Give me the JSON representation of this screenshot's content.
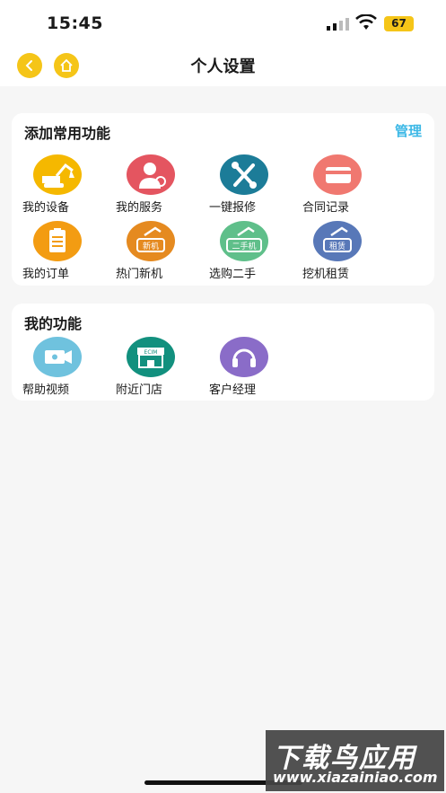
{
  "status": {
    "time": "15:45",
    "battery": "67"
  },
  "nav": {
    "title": "个人设置"
  },
  "common": {
    "title": "添加常用功能",
    "manage": "管理",
    "items": [
      {
        "label": "我的设备",
        "icon": "excavator-icon",
        "color": "#f5b800"
      },
      {
        "label": "我的服务",
        "icon": "service-person-icon",
        "color": "#e45560"
      },
      {
        "label": "一键报修",
        "icon": "tools-icon",
        "color": "#1c7c98"
      },
      {
        "label": "合同记录",
        "icon": "card-icon",
        "color": "#f07870"
      },
      {
        "label": "我的订单",
        "icon": "clipboard-icon",
        "color": "#f39c12"
      },
      {
        "label": "热门新机",
        "icon": "new-machine-icon",
        "color": "#e58a20",
        "badge": "新机"
      },
      {
        "label": "选购二手",
        "icon": "used-machine-icon",
        "color": "#5fbf8a",
        "badge": "二手机"
      },
      {
        "label": "挖机租赁",
        "icon": "rental-machine-icon",
        "color": "#5878b8",
        "badge": "租赁"
      }
    ]
  },
  "mine": {
    "title": "我的功能",
    "items": [
      {
        "label": "帮助视频",
        "icon": "video-icon",
        "color": "#6fc2de"
      },
      {
        "label": "附近门店",
        "icon": "store-icon",
        "color": "#12907e",
        "badge": "ECIM"
      },
      {
        "label": "客户经理",
        "icon": "headset-icon",
        "color": "#8a6cc8"
      }
    ]
  },
  "watermark": {
    "top": "下载鸟应用",
    "bottom": "www.xiazainiao.com"
  }
}
